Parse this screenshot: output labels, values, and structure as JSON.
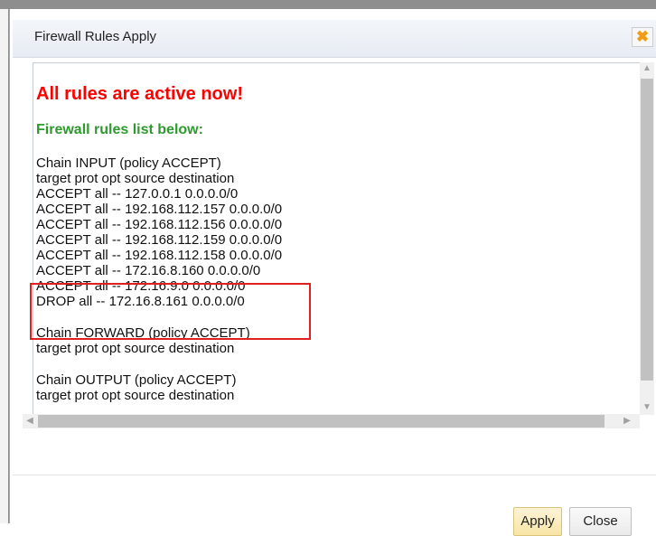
{
  "dialog": {
    "title": "Firewall Rules Apply",
    "close_glyph": "✖",
    "close_icon": "close-icon"
  },
  "content": {
    "heading": "All rules are active now!",
    "subheading": "Firewall rules list below:",
    "chain_input": {
      "title": "Chain INPUT (policy ACCEPT)",
      "columns": "target prot opt source destination",
      "rules": [
        "ACCEPT all -- 127.0.0.1 0.0.0.0/0",
        "ACCEPT all -- 192.168.112.157 0.0.0.0/0",
        "ACCEPT all -- 192.168.112.156 0.0.0.0/0",
        "ACCEPT all -- 192.168.112.159 0.0.0.0/0",
        "ACCEPT all -- 192.168.112.158 0.0.0.0/0",
        "ACCEPT all -- 172.16.8.160 0.0.0.0/0",
        "ACCEPT all -- 172.16.9.0 0.0.0.0/0",
        "DROP all -- 172.16.8.161 0.0.0.0/0"
      ]
    },
    "chain_forward": {
      "title": "Chain FORWARD (policy ACCEPT)",
      "columns": "target prot opt source destination"
    },
    "chain_output": {
      "title": "Chain OUTPUT (policy ACCEPT)",
      "columns": "target prot opt source destination"
    }
  },
  "scrollbars": {
    "up_glyph": "▲",
    "down_glyph": "▼",
    "left_glyph": "◀",
    "right_glyph": "▶"
  },
  "buttons": {
    "apply": "Apply",
    "close": "Close"
  },
  "colors": {
    "heading": "#ff0000",
    "subheading": "#2e9a2e",
    "highlight": "#e02020",
    "close_icon": "#f39c12",
    "apply_button": "#f7e4a6"
  }
}
